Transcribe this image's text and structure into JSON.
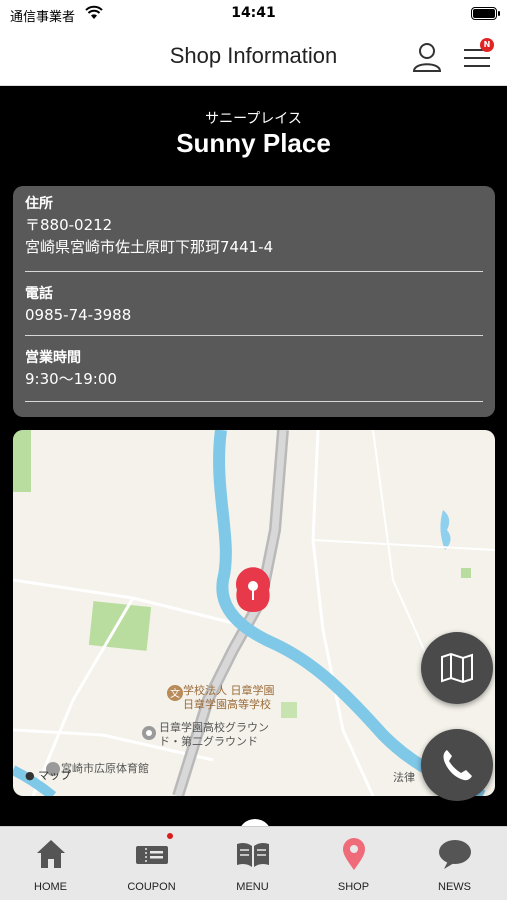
{
  "status_bar": {
    "carrier": "通信事業者",
    "time": "14:41"
  },
  "header": {
    "title": "Shop Information",
    "menu_badge": "N"
  },
  "shop": {
    "kana": "サニープレイス",
    "name": "Sunny Place"
  },
  "info": {
    "address": {
      "label": "住所",
      "postal": "〒880-0212",
      "line": "宮崎県宮崎市佐土原町下那珂7441-4"
    },
    "phone": {
      "label": "電話",
      "value": "0985-74-3988"
    },
    "hours": {
      "label": "営業時間",
      "value": "9:30〜19:00"
    }
  },
  "map": {
    "poi_school_1": "学校法人 日章学園",
    "poi_school_2": "日章学園高等学校",
    "poi_ground_1": "日章学園高校グラウン",
    "poi_ground_2": "ド・第二グラウンド",
    "poi_gym": "宮崎市広原体育館",
    "poi_road": "法律",
    "attribution": "マップ",
    "pin_color": "#e8394a",
    "river_color": "#7fc8e8"
  },
  "fabs": {
    "map_icon": "map-icon",
    "call_icon": "phone-icon"
  },
  "tabs": [
    {
      "label": "HOME",
      "icon": "home-icon"
    },
    {
      "label": "COUPON",
      "icon": "ticket-icon"
    },
    {
      "label": "MENU",
      "icon": "book-icon"
    },
    {
      "label": "SHOP",
      "icon": "location-pin-icon",
      "active_color": "#f06b7a"
    },
    {
      "label": "NEWS",
      "icon": "speech-bubble-icon"
    }
  ]
}
